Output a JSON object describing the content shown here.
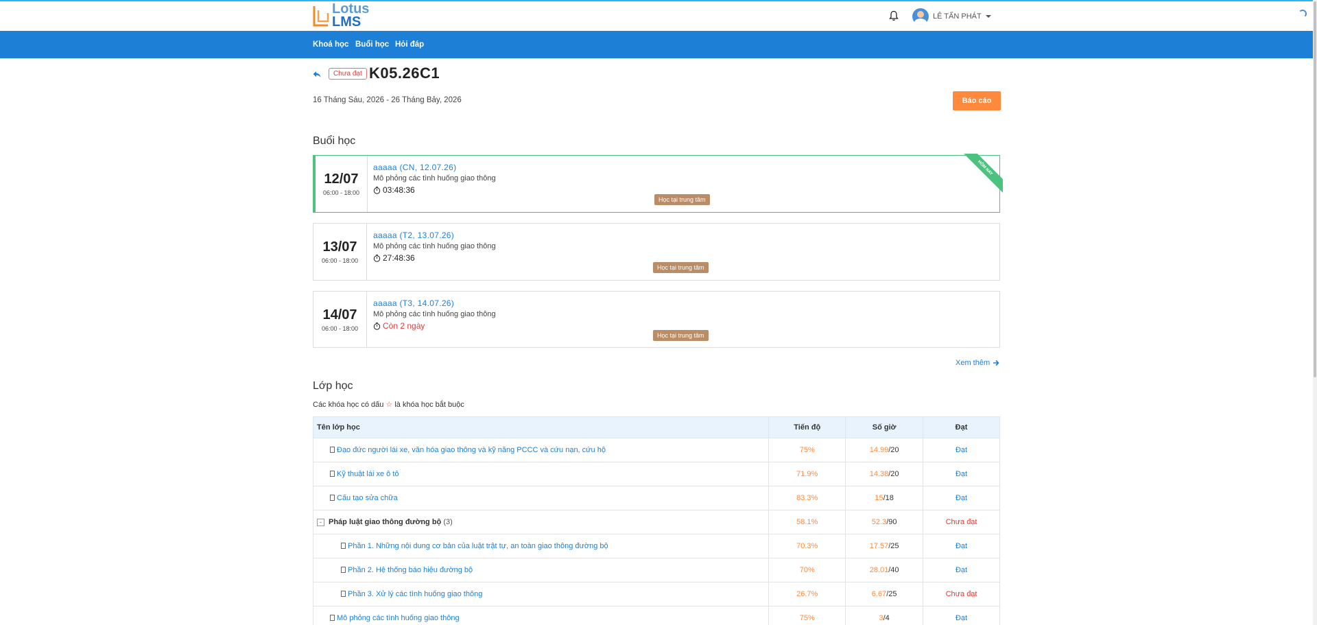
{
  "brand": {
    "line1": "Lotus",
    "line2": "LMS"
  },
  "header": {
    "user_name": "LÊ TẤN PHÁT"
  },
  "nav": [
    {
      "label": "Khoá học"
    },
    {
      "label": "Buổi học"
    },
    {
      "label": "Hỏi đáp"
    }
  ],
  "course": {
    "status_badge": "Chưa đạt",
    "code": "K05.26C1",
    "date_range": "16 Tháng Sáu, 2026 - 26 Tháng Bảy, 2026",
    "report_button": "Báo cáo"
  },
  "sessions_section": {
    "heading": "Buổi học",
    "today_ribbon": "HÔM NAY",
    "items": [
      {
        "day": "12/07",
        "time": "06:00 - 18:00",
        "title": "aaaaa (CN, 12.07.26)",
        "subtitle": "Mô phỏng các tình huống giao thông",
        "timer": "03:48:36",
        "tag": "Học tại trung tâm"
      },
      {
        "day": "13/07",
        "time": "06:00 - 18:00",
        "title": "aaaaa (T2, 13.07.26)",
        "subtitle": "Mô phỏng các tình huống giao thông",
        "timer": "27:48:36",
        "tag": "Học tại trung tâm"
      },
      {
        "day": "14/07",
        "time": "06:00 - 18:00",
        "title": "aaaaa (T3, 14.07.26)",
        "subtitle": "Mô phỏng các tình huống giao thông",
        "timer": "Còn 2 ngày",
        "tag": "Học tại trung tâm"
      }
    ],
    "see_more": "Xem thêm"
  },
  "classes_section": {
    "heading": "Lớp học",
    "note_before": "Các khóa học có dấu",
    "note_after": "là khóa học bắt buộc",
    "columns": {
      "name": "Tên lớp học",
      "progress": "Tiến độ",
      "hours": "Số giờ",
      "result": "Đạt"
    },
    "rows": [
      {
        "name": "Đạo đức người lái xe, văn hóa giao thông và kỹ năng PCCC và cứu nạn, cứu hộ",
        "progress": "75%",
        "hours_done": "14.99",
        "hours_total": "/20",
        "result": "Đạt"
      },
      {
        "name": "Kỹ thuật lái xe ô tô",
        "progress": "71.9%",
        "hours_done": "14.38",
        "hours_total": "/20",
        "result": "Đạt"
      },
      {
        "name": "Cấu tạo sửa chữa",
        "progress": "83.3%",
        "hours_done": "15",
        "hours_total": "/18",
        "result": "Đạt"
      },
      {
        "name": "Pháp luật giao thông đường bộ",
        "count": "(3)",
        "toggle": "-",
        "progress": "58.1%",
        "hours_done": "52.3",
        "hours_total": "/90",
        "result": "Chưa đạt"
      },
      {
        "name": "Phần 1. Những nội dung cơ bản của luật trật tự, an toàn giao thông đường bộ",
        "progress": "70.3%",
        "hours_done": "17.57",
        "hours_total": "/25",
        "result": "Đạt"
      },
      {
        "name": "Phần 2. Hệ thống báo hiệu đường bộ",
        "progress": "70%",
        "hours_done": "28.01",
        "hours_total": "/40",
        "result": "Đạt"
      },
      {
        "name": "Phần 3. Xử lý các tình huống giao thông",
        "progress": "26.7%",
        "hours_done": "6.67",
        "hours_total": "/25",
        "result": "Chưa đạt"
      },
      {
        "name": "Mô phỏng các tình huống giao thông",
        "progress": "75%",
        "hours_done": "3",
        "hours_total": "/4",
        "result": "Đạt"
      }
    ]
  }
}
